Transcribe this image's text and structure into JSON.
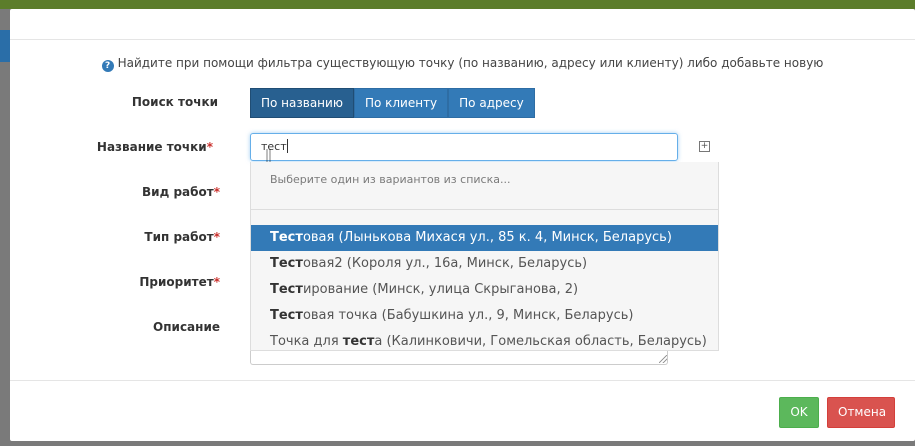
{
  "info_text": "Найдите при помощи фильтра существующую точку (по названию, адресу или клиенту) либо добавьте новую",
  "info_icon": "question-circle-icon",
  "labels": {
    "search": "Поиск точки",
    "name": "Название точки",
    "work_kind": "Вид работ",
    "work_type": "Тип работ",
    "priority": "Приоритет",
    "description": "Описание",
    "required_mark": "*"
  },
  "search_modes": [
    {
      "label": "По названию",
      "active": true
    },
    {
      "label": "По клиенту",
      "active": false
    },
    {
      "label": "По адресу",
      "active": false
    }
  ],
  "name_input": {
    "value": "тест"
  },
  "dropdown": {
    "hint": "Выберите один из вариантов из списка...",
    "items": [
      {
        "match": "Тест",
        "rest": "овая (Лынькова Михася ул., 85 к. 4, Минск, Беларусь)",
        "selected": true
      },
      {
        "match": "Тест",
        "rest": "овая2 (Короля ул., 16а, Минск, Беларусь)",
        "selected": false
      },
      {
        "match": "Тест",
        "rest": "ирование (Минск, улица Скрыганова, 2)",
        "selected": false
      },
      {
        "match": "Тест",
        "rest": "овая точка (Бабушкина ул., 9, Минск, Беларусь)",
        "selected": false
      },
      {
        "prefix": "Точка для ",
        "match": "тест",
        "rest": "а (Калинковичи, Гомельская область, Беларусь)",
        "selected": false
      }
    ]
  },
  "buttons": {
    "ok": "OK",
    "cancel": "Отмена"
  },
  "colors": {
    "primary": "#337ab7",
    "success": "#5cb85c",
    "danger": "#d9534f"
  }
}
